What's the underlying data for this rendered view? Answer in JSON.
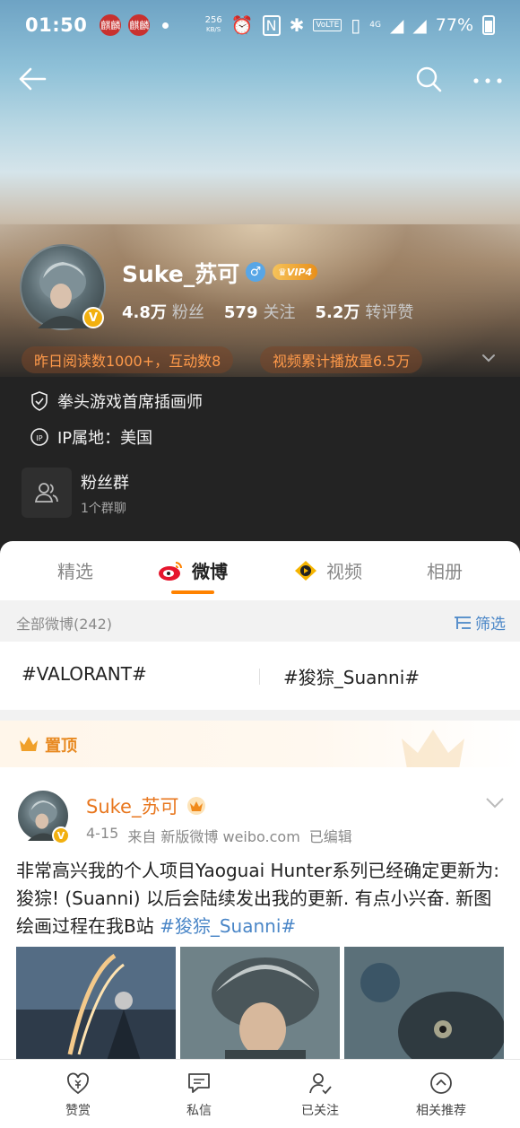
{
  "status_bar": {
    "time": "01:50",
    "notif_icon_1": "麒麟",
    "notif_icon_2": "麒麟",
    "speed_value": "256",
    "speed_unit": "KB/S",
    "battery": "77%",
    "network_label": "4G",
    "volte": "VoLTE"
  },
  "nav": {
    "back_icon": "arrow-left-icon",
    "search_icon": "search-icon",
    "more_icon": "more-icon"
  },
  "profile": {
    "username": "Suke_苏可",
    "gender_symbol": "♂",
    "vip_label": "VIP4",
    "verified_mark": "V",
    "stats": [
      {
        "value": "4.8万",
        "label": "粉丝"
      },
      {
        "value": "579",
        "label": "关注"
      },
      {
        "value": "5.2万",
        "label": "转评赞"
      }
    ],
    "pill_1": "昨日阅读数1000+，互动数8",
    "pill_2": "视频累计播放量6.5万",
    "verification": "拳头游戏首席插画师",
    "ip_location": "IP属地：美国",
    "fan_group_title": "粉丝群",
    "fan_group_sub": "1个群聊"
  },
  "tabs": [
    {
      "label": "精选",
      "active": false
    },
    {
      "label": "微博",
      "active": true
    },
    {
      "label": "视频",
      "active": false
    },
    {
      "label": "相册",
      "active": false
    }
  ],
  "filter_bar": {
    "count_label": "全部微博(242)",
    "filter_label": "筛选"
  },
  "topics": [
    "#VALORANT#",
    "#狻猔_Suanni#"
  ],
  "pinned_label": "置顶",
  "post": {
    "author": "Suke_苏可",
    "date": "4-15",
    "source": "来自 新版微博 weibo.com",
    "edited": "已编辑",
    "text_main": "非常高兴我的个人项目Yaoguai Hunter系列已经确定更新为: 狻猔! (Suanni) 以后会陆续发出我的更新. 有点小兴奋. 新图绘画过程在我B站 ",
    "text_tag": "#狻猔_Suanni#"
  },
  "bottom_bar": [
    {
      "label": "赞赏",
      "icon": "reward-icon"
    },
    {
      "label": "私信",
      "icon": "message-icon"
    },
    {
      "label": "已关注",
      "icon": "followed-icon"
    },
    {
      "label": "相关推荐",
      "icon": "recommend-icon"
    }
  ],
  "colors": {
    "accent": "#ff8200",
    "link": "#4a86c7",
    "pill_text": "#ff9a4a",
    "name_orange": "#e8771f"
  }
}
